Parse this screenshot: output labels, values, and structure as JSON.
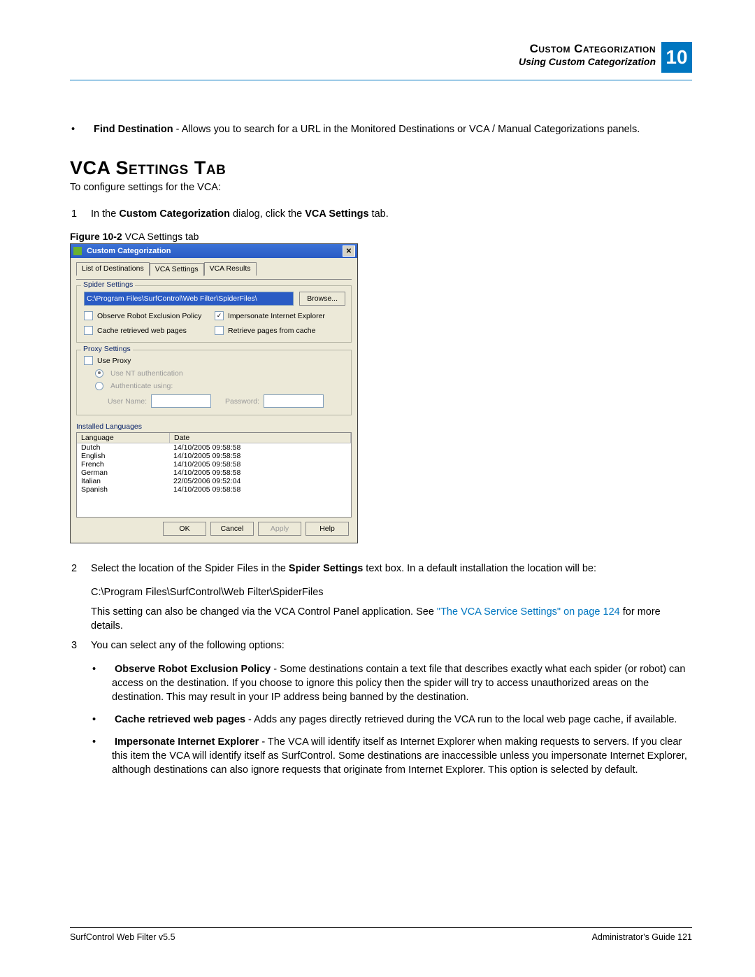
{
  "header": {
    "title_line1": "Custom Categorization",
    "title_line2": "Using Custom Categorization",
    "chapter_number": "10"
  },
  "intro_bullet": {
    "bold": "Find Destination",
    "rest": " - Allows you to search for a URL in the Monitored Destinations or VCA / Manual Categorizations panels."
  },
  "section_heading": "VCA Settings Tab",
  "section_intro": "To configure settings for the VCA:",
  "step1": {
    "num": "1",
    "pre": "In the ",
    "bold1": "Custom Categorization",
    "mid": " dialog, click the ",
    "bold2": "VCA Settings",
    "post": " tab."
  },
  "figure_caption": {
    "label": "Figure 10-2",
    "text": "  VCA Settings tab"
  },
  "dialog": {
    "title": "Custom Categorization",
    "tabs": [
      "List of Destinations",
      "VCA Settings",
      "VCA Results"
    ],
    "active_tab_index": 1,
    "spider_group": {
      "legend": "Spider Settings",
      "path_value": "C:\\Program Files\\SurfControl\\Web Filter\\SpiderFiles\\",
      "browse": "Browse...",
      "cb_observe": "Observe Robot Exclusion Policy",
      "cb_impersonate": "Impersonate Internet Explorer",
      "cb_cache": "Cache retrieved web pages",
      "cb_retrieve": "Retrieve pages from cache",
      "impersonate_checked": true
    },
    "proxy_group": {
      "legend": "Proxy Settings",
      "cb_useproxy": "Use Proxy",
      "radio_nt": "Use NT authentication",
      "radio_auth": "Authenticate using:",
      "user_label": "User Name:",
      "pass_label": "Password:"
    },
    "lang_label": "Installed Languages",
    "lang_headers": [
      "Language",
      "Date"
    ],
    "lang_rows": [
      {
        "lang": "Dutch",
        "date": "14/10/2005 09:58:58"
      },
      {
        "lang": "English",
        "date": "14/10/2005 09:58:58"
      },
      {
        "lang": "French",
        "date": "14/10/2005 09:58:58"
      },
      {
        "lang": "German",
        "date": "14/10/2005 09:58:58"
      },
      {
        "lang": "Italian",
        "date": "22/05/2006 09:52:04"
      },
      {
        "lang": "Spanish",
        "date": "14/10/2005 09:58:58"
      }
    ],
    "buttons": {
      "ok": "OK",
      "cancel": "Cancel",
      "apply": "Apply",
      "help": "Help"
    }
  },
  "step2": {
    "num": "2",
    "pre": "Select the location of the Spider Files in the ",
    "bold": "Spider Settings",
    "post": " text box. In a default installation the location will be:",
    "path": "C:\\Program Files\\SurfControl\\Web Filter\\SpiderFiles",
    "para2_pre": "This setting can also be changed via the VCA Control Panel application. See ",
    "para2_link": "\"The VCA Service Settings\" on page 124",
    "para2_post": " for more details."
  },
  "step3": {
    "num": "3",
    "intro": "You can select any of the following options:",
    "items": [
      {
        "bold": "Observe Robot Exclusion Policy",
        "rest": " - Some destinations contain a text file that describes exactly what each spider (or robot) can access on the destination. If you choose to ignore this policy then the spider will try to access unauthorized areas on the destination. This may result in your IP address being banned by the destination."
      },
      {
        "bold": "Cache retrieved web pages",
        "rest": " - Adds any pages directly retrieved during the VCA run to the local web page cache, if available."
      },
      {
        "bold": "Impersonate Internet Explorer",
        "rest": " - The VCA will identify itself as Internet Explorer when making requests to servers. If you clear this item the VCA will identify itself as SurfControl. Some destinations are inaccessible unless you impersonate Internet Explorer, although destinations can also ignore requests that originate from Internet Explorer. This option is selected by default."
      }
    ]
  },
  "footer": {
    "left": "SurfControl Web Filter v5.5",
    "right": "Administrator's Guide   121"
  }
}
